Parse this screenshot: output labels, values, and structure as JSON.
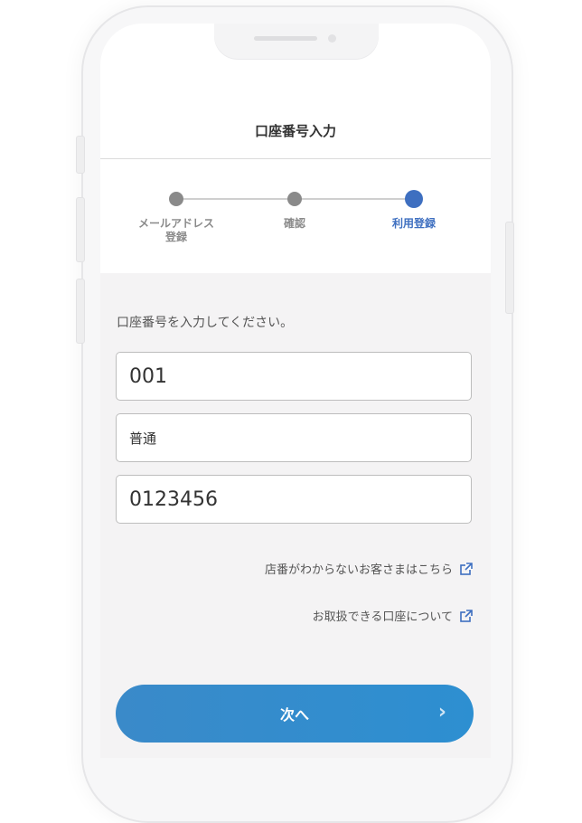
{
  "header": {
    "title": "口座番号入力"
  },
  "stepper": {
    "steps": [
      {
        "label_line1": "メールアドレス",
        "label_line2": "登録",
        "state": "done"
      },
      {
        "label_line1": "確認",
        "label_line2": "",
        "state": "done"
      },
      {
        "label_line1": "利用登録",
        "label_line2": "",
        "state": "current"
      }
    ]
  },
  "form": {
    "instruction": "口座番号を入力してください。",
    "branch_value": "001",
    "account_type_value": "普通",
    "account_number_value": "0123456"
  },
  "links": {
    "branch_help": "店番がわからないお客さまはこちら",
    "accounts_info": "お取扱できる口座について"
  },
  "actions": {
    "next_label": "次へ"
  },
  "colors": {
    "accent": "#3e6fc0",
    "button": "#3a8ac9",
    "inactive": "#8a8a8a"
  },
  "icons": {
    "external_link": "external-link-icon",
    "next": "chevron-right-icon"
  }
}
